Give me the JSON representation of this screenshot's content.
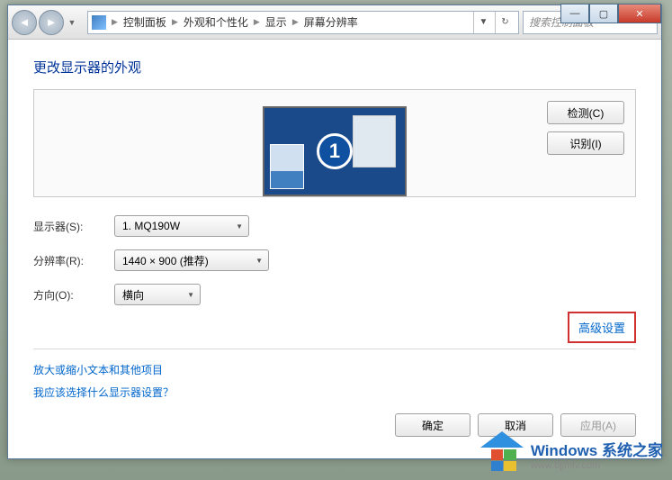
{
  "breadcrumb": {
    "items": [
      "控制面板",
      "外观和个性化",
      "显示",
      "屏幕分辨率"
    ]
  },
  "search": {
    "placeholder": "搜索控制面板"
  },
  "page": {
    "title": "更改显示器的外观"
  },
  "monitor": {
    "number": "1",
    "detect_btn": "检测(C)",
    "identify_btn": "识别(I)"
  },
  "form": {
    "display_label": "显示器(S):",
    "display_value": "1. MQ190W",
    "resolution_label": "分辨率(R):",
    "resolution_value": "1440 × 900 (推荐)",
    "orientation_label": "方向(O):",
    "orientation_value": "横向"
  },
  "links": {
    "advanced": "高级设置",
    "textsize": "放大或缩小文本和其他项目",
    "which_monitor": "我应该选择什么显示器设置？"
  },
  "buttons": {
    "ok": "确定",
    "cancel": "取消",
    "apply": "应用(A)"
  },
  "watermark": {
    "title": "Windows 系统之家",
    "url": "www.bjjmlv.com"
  }
}
